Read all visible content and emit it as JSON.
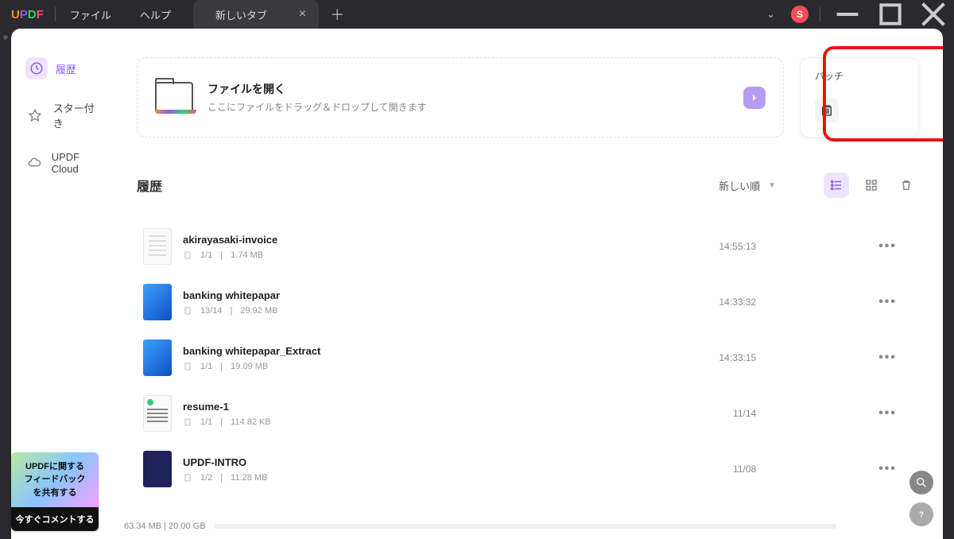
{
  "titlebar": {
    "menu_file": "ファイル",
    "menu_help": "ヘルプ",
    "tab_label": "新しいタブ",
    "avatar_letter": "S"
  },
  "sidebar": {
    "history": "履歴",
    "starred": "スター付き",
    "cloud": "UPDF Cloud"
  },
  "open": {
    "title": "ファイルを開く",
    "subtitle": "ここにファイルをドラッグ＆ドロップして開きます"
  },
  "batch": {
    "title": "バッチ"
  },
  "section": {
    "title": "履歴",
    "sort_label": "新しい順"
  },
  "files": [
    {
      "name": "akirayasaki-invoice",
      "pages": "1/1",
      "size": "1.74 MB",
      "time": "14:55:13",
      "thumb": "doc"
    },
    {
      "name": "banking whitepapar",
      "pages": "13/14",
      "size": "29.92 MB",
      "time": "14:33:32",
      "thumb": "blue"
    },
    {
      "name": "banking whitepapar_Extract",
      "pages": "1/1",
      "size": "19.09 MB",
      "time": "14:33:15",
      "thumb": "blue"
    },
    {
      "name": "resume-1",
      "pages": "1/1",
      "size": "114.82 KB",
      "time": "11/14",
      "thumb": "resume"
    },
    {
      "name": "UPDF-INTRO",
      "pages": "1/2",
      "size": "11.28 MB",
      "time": "11/08",
      "thumb": "dark"
    }
  ],
  "status": {
    "text": "63.34 MB | 20.00 GB"
  },
  "feedback": {
    "line1": "UPDFに関する",
    "line2": "フィードバック",
    "line3": "を共有する",
    "button": "今すぐコメントする"
  }
}
